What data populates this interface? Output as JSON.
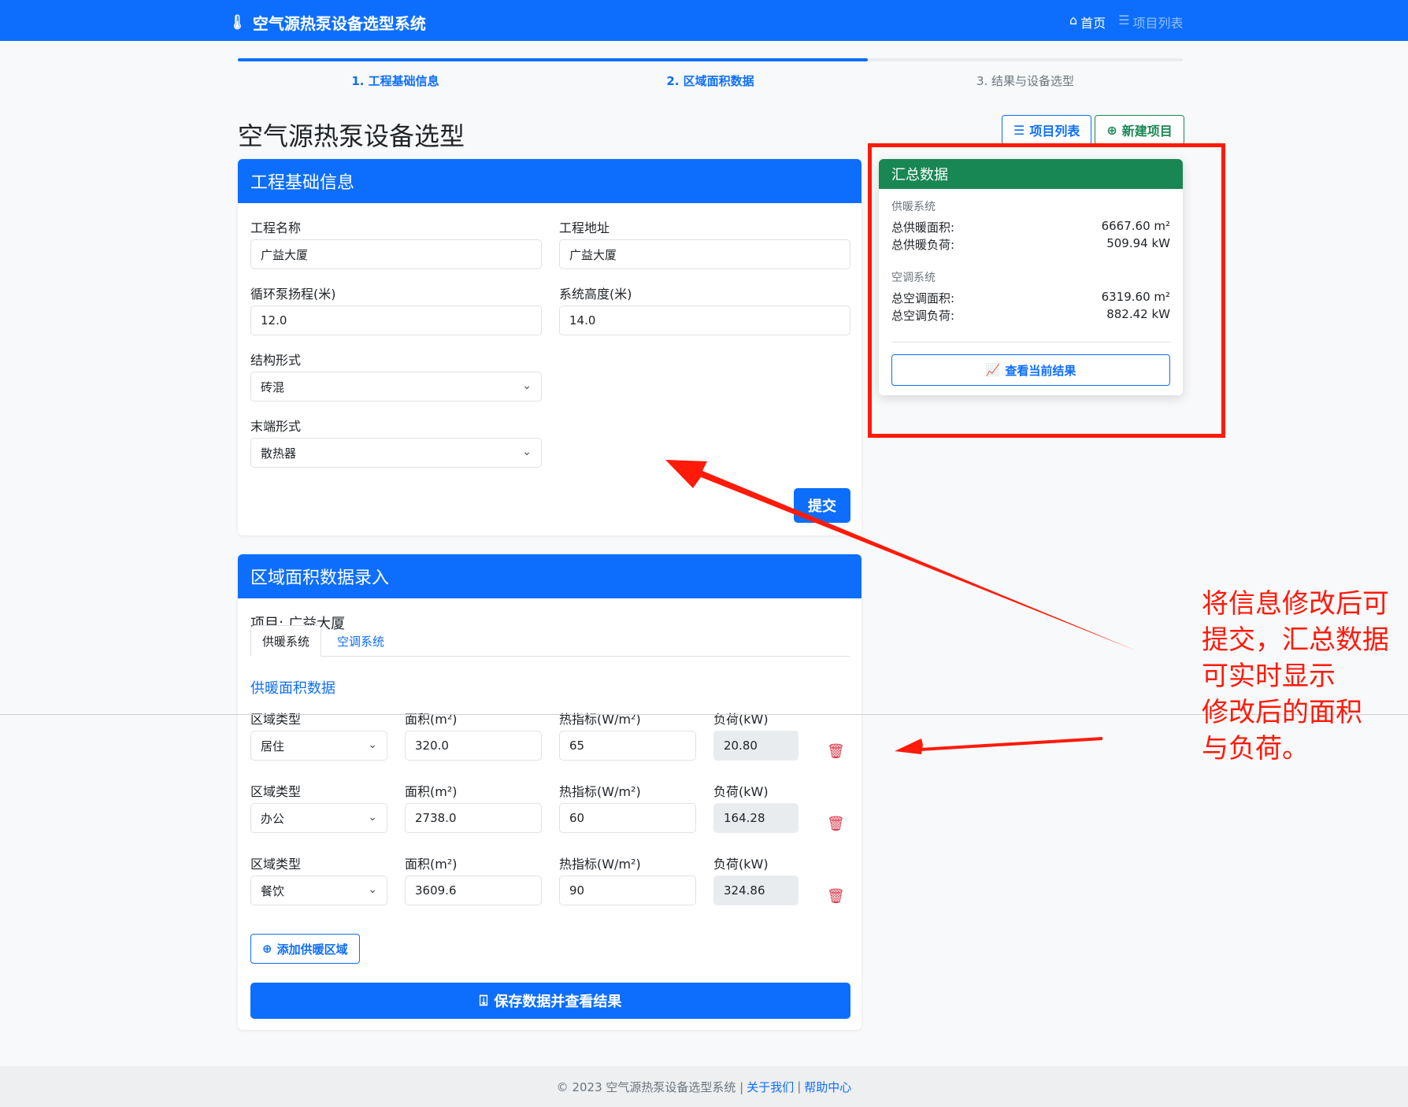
{
  "navbar": {
    "brand": "空气源热泵设备选型系统",
    "home": "首页",
    "project_list": "项目列表"
  },
  "steps": [
    {
      "label": "1. 工程基础信息",
      "state": "active"
    },
    {
      "label": "2. 区域面积数据",
      "state": "active"
    },
    {
      "label": "3. 结果与设备选型",
      "state": "pending"
    }
  ],
  "progress_fraction": 0.667,
  "page": {
    "title": "空气源热泵设备选型",
    "btn_project_list": "项目列表",
    "btn_new_project": "新建项目"
  },
  "basic": {
    "header": "工程基础信息",
    "name_label": "工程名称",
    "name_value": "广益大厦",
    "address_label": "工程地址",
    "address_value": "广益大厦",
    "pump_label": "循环泵扬程(米)",
    "pump_value": "12.0",
    "height_label": "系统高度(米)",
    "height_value": "14.0",
    "structure_label": "结构形式",
    "structure_value": "砖混",
    "terminal_label": "末端形式",
    "terminal_value": "散热器",
    "submit": "提交"
  },
  "area": {
    "header": "区域面积数据录入",
    "project_prefix": "项目:",
    "project_name": "广益大厦",
    "tab_heating": "供暖系统",
    "tab_cooling": "空调系统",
    "section_title": "供暖面积数据",
    "col_type": "区域类型",
    "col_area": "面积(m²)",
    "col_index": "热指标(W/m²)",
    "col_load": "负荷(kW)",
    "rows": [
      {
        "type": "居住",
        "area": "320.0",
        "index": "65",
        "load": "20.80"
      },
      {
        "type": "办公",
        "area": "2738.0",
        "index": "60",
        "load": "164.28"
      },
      {
        "type": "餐饮",
        "area": "3609.6",
        "index": "90",
        "load": "324.86"
      }
    ],
    "add_btn": "添加供暖区域",
    "save_btn": "保存数据并查看结果"
  },
  "summary": {
    "header": "汇总数据",
    "heating_title": "供暖系统",
    "heating_area_label": "总供暖面积:",
    "heating_area_value": "6667.60 m²",
    "heating_load_label": "总供暖负荷:",
    "heating_load_value": "509.94 kW",
    "cooling_title": "空调系统",
    "cooling_area_label": "总空调面积:",
    "cooling_area_value": "6319.60 m²",
    "cooling_load_label": "总空调负荷:",
    "cooling_load_value": "882.42 kW",
    "view_btn": "查看当前结果"
  },
  "annotation": {
    "line1": "将信息修改后可",
    "line2": "提交，汇总数据",
    "line3": "可实时显示",
    "line4": "修改后的面积",
    "line5": "与负荷。"
  },
  "footer": {
    "copyright": "© 2023 空气源热泵设备选型系统 |",
    "about": "关于我们",
    "sep": "|",
    "help": "帮助中心"
  },
  "colors": {
    "primary": "#0d6efd",
    "success": "#198754",
    "danger": "#dc3545",
    "annotation_red": "#ff1a0a"
  }
}
